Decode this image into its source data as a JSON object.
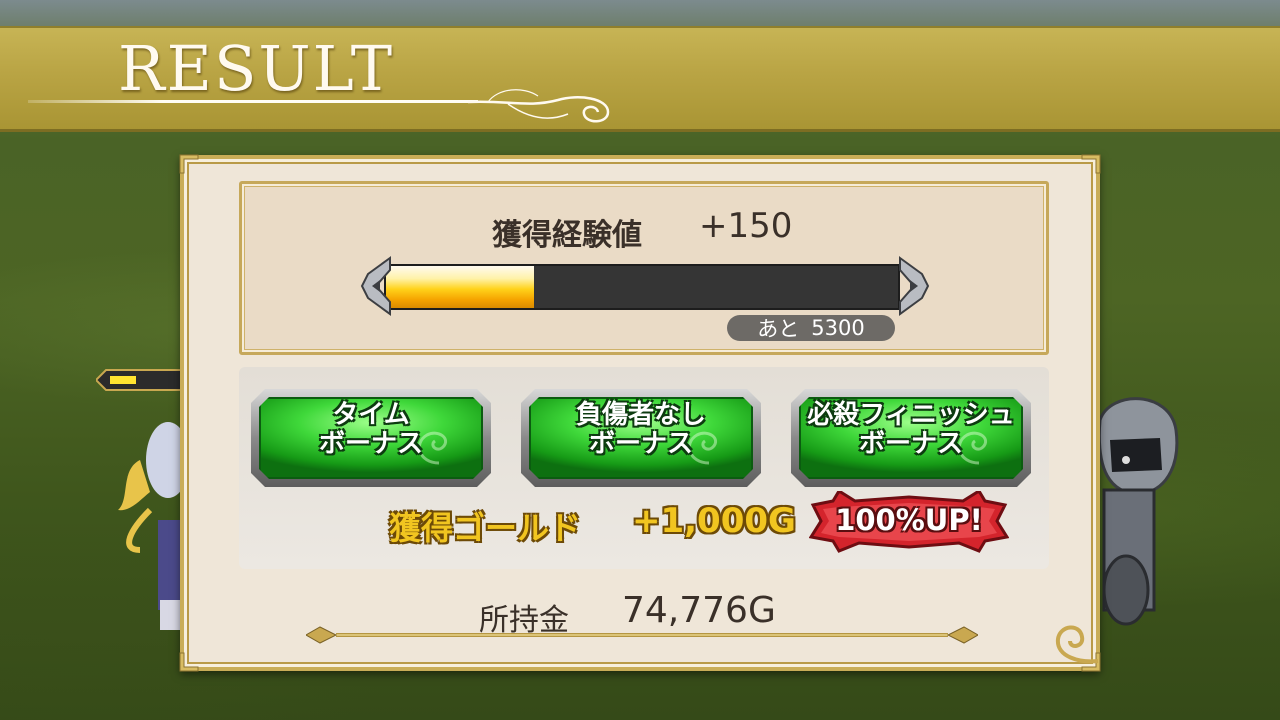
{
  "banner": {
    "title": "RESULT"
  },
  "exp": {
    "label": "獲得経験値",
    "value": "+150",
    "progress_fraction": 0.29,
    "remain_prefix": "あと",
    "remain_value": "5300"
  },
  "bonuses": [
    {
      "line1": "タイム",
      "line2": "ボーナス"
    },
    {
      "line1": "負傷者なし",
      "line2": "ボーナス"
    },
    {
      "line1": "必殺フィニッシュ",
      "line2": "ボーナス"
    }
  ],
  "gold": {
    "label": "獲得ゴールド",
    "value": "+1,000G",
    "badge": "100%UP!"
  },
  "money": {
    "label": "所持金",
    "value": "74,776G"
  },
  "colors": {
    "banner": "#b9a444",
    "bonus_green": "#3fd83a",
    "gold_text": "#f1c520",
    "badge_red": "#d4242c"
  }
}
